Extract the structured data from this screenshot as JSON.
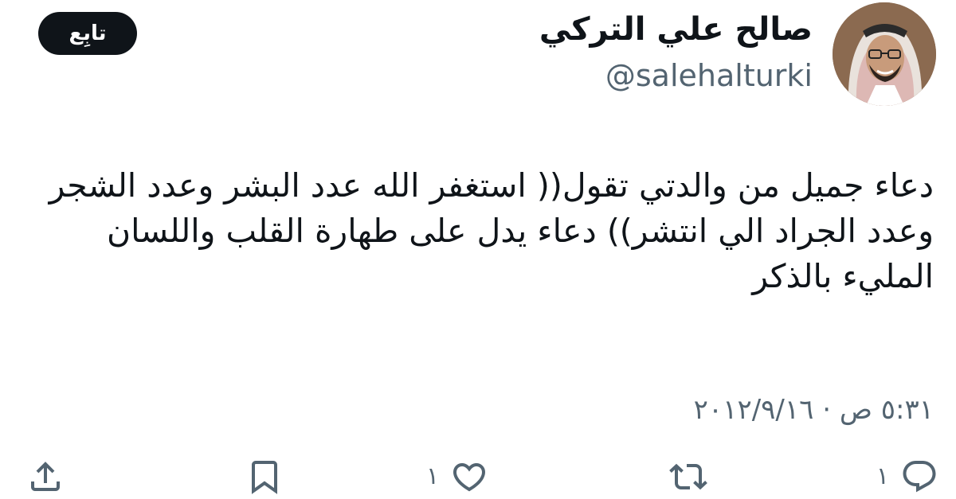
{
  "author": {
    "display_name": "صالح علي التركي",
    "handle": "@salehalturki"
  },
  "follow_button": {
    "label": "تابِع"
  },
  "tweet": {
    "text": "دعاء جميل من والدتي تقول(( استغفر الله عدد البشر وعدد الشجر وعدد الجراد الي انتشر)) دعاء يدل على طهارة القلب واللسان المليء بالذكر",
    "timestamp": "٥:٣١ ص · ٢٠١٢/٩/١٦"
  },
  "actions": {
    "reply": {
      "icon": "reply-icon",
      "count": "١"
    },
    "retweet": {
      "icon": "retweet-icon"
    },
    "like": {
      "icon": "heart-icon",
      "count": "١"
    },
    "bookmark": {
      "icon": "bookmark-icon"
    },
    "share": {
      "icon": "share-icon"
    }
  },
  "colors": {
    "text": "#0f1419",
    "secondary": "#536471",
    "button_bg": "#0f1419",
    "button_text": "#ffffff"
  }
}
